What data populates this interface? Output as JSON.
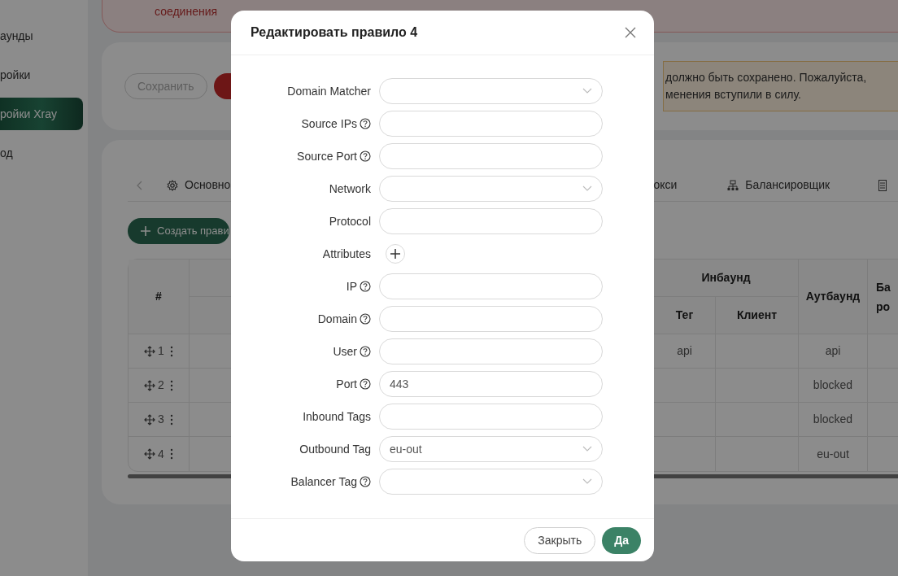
{
  "sidebar": {
    "items": [
      {
        "label": "аунды",
        "selected": false
      },
      {
        "label": "ройки",
        "selected": false
      },
      {
        "label": "ройки Xray",
        "selected": true
      },
      {
        "label": "од",
        "selected": false
      }
    ]
  },
  "error_alert": {
    "text": "соединения"
  },
  "save_card": {
    "buttons": [
      {
        "label": "Сохранить",
        "kind": "outline",
        "disabled": true
      },
      {
        "kind": "danger"
      }
    ],
    "warning": [
      "должно быть сохранено. Пожалуйста,",
      "менения вступили в силу."
    ]
  },
  "tabs": [
    {
      "label": "Основно",
      "kind": "gear"
    },
    {
      "label": "окси",
      "kind": "plain"
    },
    {
      "label": "Балансировщик",
      "kind": "balancer"
    },
    {
      "kind": "doc"
    }
  ],
  "create_button": {
    "label": "Создать прави"
  },
  "table": {
    "columns": {
      "index": "#",
      "inbound": "Инбаунд",
      "inbound_tag": "Тег",
      "client": "Клиент",
      "outbound": "Аутбаунд",
      "column_last": "Ба ро"
    },
    "rows": [
      {
        "index": "1",
        "inbound_tag": "api",
        "outbound": "api"
      },
      {
        "index": "2",
        "outbound": "blocked"
      },
      {
        "index": "3",
        "outbound": "blocked"
      },
      {
        "index": "4",
        "outbound": "eu-out"
      }
    ]
  },
  "modal": {
    "title": "Редактировать правило 4",
    "fields": [
      {
        "label": "Domain Matcher",
        "kind": "select",
        "help": false
      },
      {
        "label": "Source IPs",
        "kind": "text",
        "help": true
      },
      {
        "label": "Source Port",
        "kind": "text",
        "help": true
      },
      {
        "label": "Network",
        "kind": "select",
        "help": false
      },
      {
        "label": "Protocol",
        "kind": "text",
        "help": false
      },
      {
        "label": "Attributes",
        "kind": "add",
        "help": false
      },
      {
        "label": "IP",
        "kind": "text",
        "help": true
      },
      {
        "label": "Domain",
        "kind": "text",
        "help": true
      },
      {
        "label": "User",
        "kind": "text",
        "help": true
      },
      {
        "label": "Port",
        "kind": "text",
        "help": true,
        "value": "443"
      },
      {
        "label": "Inbound Tags",
        "kind": "text",
        "help": false
      },
      {
        "label": "Outbound Tag",
        "kind": "select",
        "help": false,
        "value": "eu-out"
      },
      {
        "label": "Balancer Tag",
        "kind": "select",
        "help": true
      }
    ],
    "buttons": [
      {
        "label": "Закрыть",
        "kind": "outline"
      },
      {
        "label": "Да",
        "kind": "primary"
      }
    ]
  }
}
